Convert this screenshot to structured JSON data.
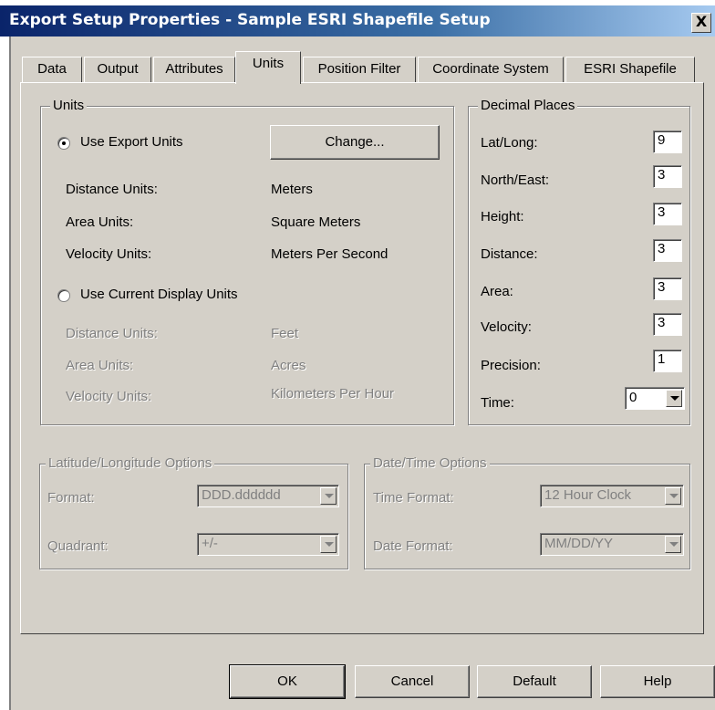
{
  "window": {
    "title": "Export Setup Properties - Sample ESRI Shapefile Setup",
    "close_glyph": "X"
  },
  "tabs": [
    "Data",
    "Output",
    "Attributes",
    "Units",
    "Position Filter",
    "Coordinate System",
    "ESRI Shapefile"
  ],
  "units": {
    "group_label": "Units",
    "use_export_label": "Use Export Units",
    "change_label": "Change...",
    "export": [
      {
        "label": "Distance Units:",
        "value": "Meters"
      },
      {
        "label": "Area Units:",
        "value": "Square Meters"
      },
      {
        "label": "Velocity Units:",
        "value": "Meters Per Second"
      }
    ],
    "use_display_label": "Use Current Display Units",
    "display": [
      {
        "label": "Distance Units:",
        "value": "Feet"
      },
      {
        "label": "Area Units:",
        "value": "Acres"
      },
      {
        "label": "Velocity Units:",
        "value": "Kilometers Per Hour"
      }
    ]
  },
  "decimal": {
    "group_label": "Decimal Places",
    "rows": [
      {
        "label": "Lat/Long:",
        "value": "9"
      },
      {
        "label": "North/East:",
        "value": "3"
      },
      {
        "label": "Height:",
        "value": "3"
      },
      {
        "label": "Distance:",
        "value": "3"
      },
      {
        "label": "Area:",
        "value": "3"
      },
      {
        "label": "Velocity:",
        "value": "3"
      },
      {
        "label": "Precision:",
        "value": "1"
      }
    ],
    "time_label": "Time:",
    "time_value": "0"
  },
  "latlong": {
    "group_label": "Latitude/Longitude Options",
    "format_label": "Format:",
    "format_value": "DDD.dddddd",
    "quadrant_label": "Quadrant:",
    "quadrant_value": "+/-"
  },
  "datetime": {
    "group_label": "Date/Time Options",
    "time_format_label": "Time Format:",
    "time_format_value": "12 Hour Clock",
    "date_format_label": "Date Format:",
    "date_format_value": "MM/DD/YY"
  },
  "buttons": {
    "ok": "OK",
    "cancel": "Cancel",
    "default": "Default",
    "help": "Help"
  }
}
